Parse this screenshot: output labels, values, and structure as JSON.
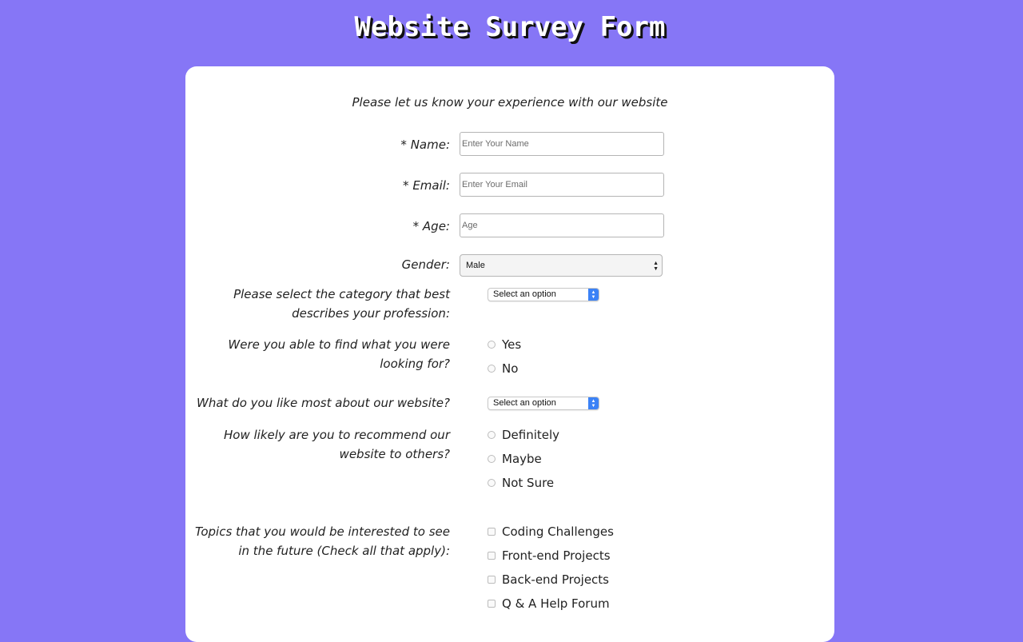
{
  "header": {
    "title": "Website Survey Form"
  },
  "form": {
    "intro": "Please let us know your experience with our website",
    "name": {
      "label": "* Name:",
      "placeholder": "Enter Your Name",
      "value": ""
    },
    "email": {
      "label": "* Email:",
      "placeholder": "Enter Your Email",
      "value": ""
    },
    "age": {
      "label": "* Age:",
      "placeholder": "Age",
      "value": ""
    },
    "gender": {
      "label": "Gender:",
      "selected": "Male"
    },
    "profession": {
      "label_line1": "Please select the category that best",
      "label_line2": "describes your profession:",
      "selected": "Select an option"
    },
    "found": {
      "label_line1": "Were you able to find what you were",
      "label_line2": "looking for?",
      "options": [
        "Yes",
        "No"
      ]
    },
    "like_most": {
      "label": "What do you like most about our website?",
      "selected": "Select an option"
    },
    "recommend": {
      "label_line1": "How likely are you to recommend our",
      "label_line2": "website to others?",
      "options": [
        "Definitely",
        "Maybe",
        "Not Sure"
      ]
    },
    "topics": {
      "label_line1": "Topics that you would be interested to see",
      "label_line2": "in the future (Check all that apply):",
      "options": [
        "Coding Challenges",
        "Front-end Projects",
        "Back-end Projects",
        "Q & A Help Forum"
      ]
    }
  },
  "colors": {
    "background": "#8676f6",
    "card": "#ffffff",
    "select_accent": "#3b82f6"
  }
}
